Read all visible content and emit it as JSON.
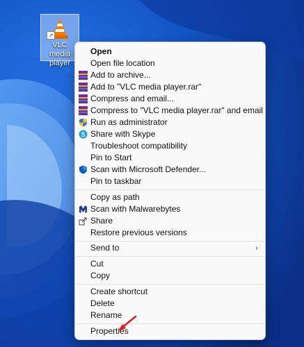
{
  "desktop": {
    "icon_label": "VLC media player"
  },
  "menu": {
    "open": "Open",
    "open_file_location": "Open file location",
    "add_to_archive": "Add to archive...",
    "add_to_rar": "Add to \"VLC media player.rar\"",
    "compress_email": "Compress and email...",
    "compress_rar_email": "Compress to \"VLC media player.rar\" and email",
    "run_as_admin": "Run as administrator",
    "share_skype": "Share with Skype",
    "troubleshoot": "Troubleshoot compatibility",
    "pin_start": "Pin to Start",
    "scan_defender": "Scan with Microsoft Defender...",
    "pin_taskbar": "Pin to taskbar",
    "copy_as_path": "Copy as path",
    "scan_malwarebytes": "Scan with Malwarebytes",
    "share": "Share",
    "restore_versions": "Restore previous versions",
    "send_to": "Send to",
    "cut": "Cut",
    "copy": "Copy",
    "create_shortcut": "Create shortcut",
    "delete": "Delete",
    "rename": "Rename",
    "properties": "Properties"
  }
}
